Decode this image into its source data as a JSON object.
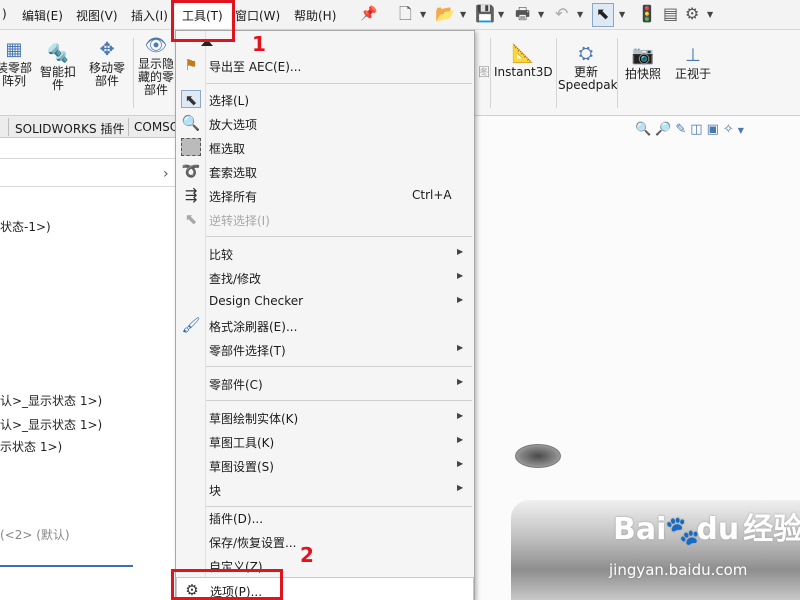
{
  "menubar": {
    "items": [
      ")",
      "编辑(E)",
      "视图(V)",
      "插入(I)",
      "工具(T)",
      "窗口(W)",
      "帮助(H)"
    ]
  },
  "ribbon": {
    "buttons": [
      {
        "label": "装零部\n阵列",
        "icon": "pattern-icon"
      },
      {
        "label": "智能扣\n件",
        "icon": "smart-fastener-icon"
      },
      {
        "label": "移动零\n部件",
        "icon": "move-component-icon"
      },
      {
        "label": "显示隐\n藏的零\n部件",
        "icon": "show-hidden-icon"
      },
      {
        "label": "Instant3D",
        "icon": "instant3d-icon"
      },
      {
        "label": "更新\nSpeedpak",
        "icon": "speedpak-icon"
      },
      {
        "label": "拍快照",
        "icon": "camera-icon"
      },
      {
        "label": "正视于",
        "icon": "normal-to-icon"
      }
    ],
    "hidden_partial": "图"
  },
  "tabs": [
    "SOLIDWORKS 插件",
    "COMSO"
  ],
  "tree": {
    "lines": [
      "状态-1>)",
      "认>_显示状态 1>)",
      "认>_显示状态 1>)",
      "示状态 1>)",
      "(<2> (默认)"
    ]
  },
  "tools_menu": {
    "items": [
      {
        "label": "导出至 AEC(E)...",
        "icon": "aec-icon",
        "submenu": false,
        "disabled": false
      },
      {
        "label": "选择(L)",
        "icon": "select-arrow-icon",
        "submenu": false,
        "disabled": false
      },
      {
        "label": "放大选项",
        "icon": "magnifier-icon",
        "submenu": false,
        "disabled": false
      },
      {
        "label": "框选取",
        "icon": "box-select-icon",
        "submenu": false,
        "disabled": false
      },
      {
        "label": "套索选取",
        "icon": "lasso-icon",
        "submenu": false,
        "disabled": false
      },
      {
        "label": "选择所有",
        "icon": "select-all-icon",
        "shortcut": "Ctrl+A",
        "submenu": false,
        "disabled": false
      },
      {
        "label": "逆转选择(I)",
        "icon": "invert-select-icon",
        "submenu": false,
        "disabled": true
      },
      {
        "label": "比较",
        "submenu": true,
        "disabled": false
      },
      {
        "label": "查找/修改",
        "submenu": true,
        "disabled": false
      },
      {
        "label": "Design Checker",
        "submenu": true,
        "disabled": false
      },
      {
        "label": "格式涂刷器(E)...",
        "icon": "format-painter-icon",
        "submenu": false,
        "disabled": false
      },
      {
        "label": "零部件选择(T)",
        "submenu": true,
        "disabled": false
      },
      {
        "label": "零部件(C)",
        "submenu": true,
        "disabled": false
      },
      {
        "label": "草图绘制实体(K)",
        "submenu": true,
        "disabled": false
      },
      {
        "label": "草图工具(K)",
        "submenu": true,
        "disabled": false
      },
      {
        "label": "草图设置(S)",
        "submenu": true,
        "disabled": false
      },
      {
        "label": "块",
        "submenu": true,
        "disabled": false
      },
      {
        "label": "插件(D)...",
        "submenu": false,
        "disabled": false
      },
      {
        "label": "保存/恢复设置...",
        "submenu": false,
        "disabled": false
      },
      {
        "label": "自定义(Z)...",
        "submenu": false,
        "disabled": false
      },
      {
        "label": "选项(P)...",
        "icon": "gear-icon",
        "submenu": false,
        "disabled": false
      }
    ]
  },
  "annotations": {
    "step1": "1",
    "step2": "2"
  },
  "watermark": {
    "brand": "Bai",
    "brand2": "du",
    "suffix": "经验",
    "url": "jingyan.baidu.com"
  },
  "colors": {
    "accent_red": "#e0141e",
    "accent_blue": "#3a6fb8"
  }
}
